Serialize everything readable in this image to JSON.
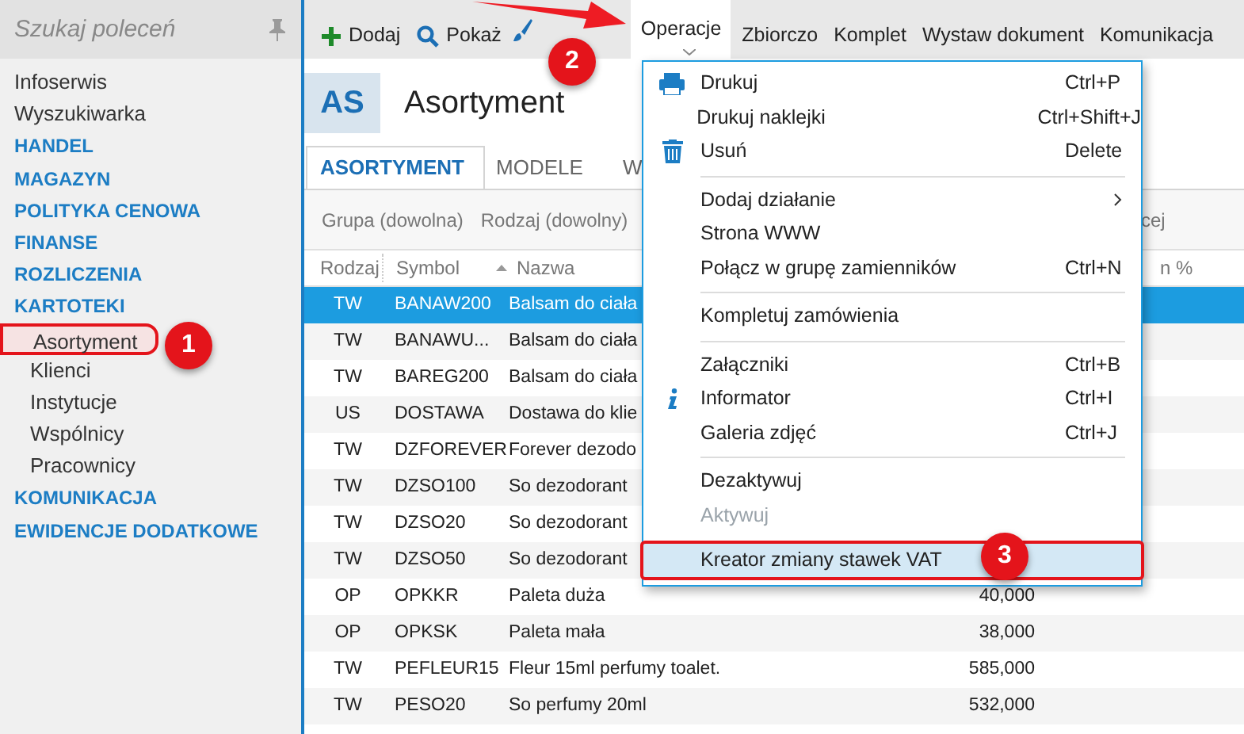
{
  "sidebar": {
    "search": {
      "placeholder": "Szukaj poleceń"
    },
    "items": [
      {
        "label": "Infoserwis",
        "kind": "link"
      },
      {
        "label": "Wyszukiwarka",
        "kind": "link"
      },
      {
        "label": "HANDEL",
        "kind": "section"
      },
      {
        "label": "MAGAZYN",
        "kind": "section"
      },
      {
        "label": "POLITYKA CENOWA",
        "kind": "section"
      },
      {
        "label": "FINANSE",
        "kind": "section"
      },
      {
        "label": "ROZLICZENIA",
        "kind": "section"
      },
      {
        "label": "KARTOTEKI",
        "kind": "section",
        "children": [
          {
            "label": "Asortyment",
            "selected": true
          },
          {
            "label": "Klienci",
            "selected": false
          },
          {
            "label": "Instytucje",
            "selected": false
          },
          {
            "label": "Wspólnicy",
            "selected": false
          },
          {
            "label": "Pracownicy",
            "selected": false
          }
        ]
      },
      {
        "label": "KOMUNIKACJA",
        "kind": "section"
      },
      {
        "label": "EWIDENCJE DODATKOWE",
        "kind": "section"
      }
    ]
  },
  "toolbar": [
    {
      "label": "Dodaj",
      "selected": false
    },
    {
      "label": "Pokaż",
      "selected": false
    },
    {
      "selected": false
    },
    {
      "label": "Operacje",
      "selected": true
    },
    {
      "label": "Zbiorczo",
      "selected": false
    },
    {
      "label": "Komplet",
      "selected": false
    },
    {
      "label": "Wystaw dokument",
      "selected": false
    },
    {
      "label": "Komunikacja",
      "selected": false
    }
  ],
  "header": {
    "badge": "AS",
    "title": "Asortyment"
  },
  "tabs": [
    {
      "label": "ASORTYMENT",
      "selected": true
    },
    {
      "label": "MODELE",
      "selected": false
    },
    {
      "label": "W",
      "selected": false
    }
  ],
  "filters": [
    "Grupa (dowolna)",
    "Rodzaj (dowolny)"
  ],
  "filter_right": "cej",
  "table": {
    "columns": [
      "Rodzaj",
      "Symbol",
      "Nazwa"
    ],
    "column_right": "n %",
    "rows": [
      {
        "rodzaj": "TW",
        "symbol": "BANAW200",
        "nazwa": "Balsam do ciała",
        "selected": true
      },
      {
        "rodzaj": "TW",
        "symbol": "BANAWU...",
        "nazwa": "Balsam do ciała",
        "selected": false
      },
      {
        "rodzaj": "TW",
        "symbol": "BAREG200",
        "nazwa": "Balsam do ciała",
        "selected": false
      },
      {
        "rodzaj": "US",
        "symbol": "DOSTAWA",
        "nazwa": "Dostawa do klie",
        "selected": false
      },
      {
        "rodzaj": "TW",
        "symbol": "DZFOREVER",
        "nazwa": "Forever dezodo",
        "selected": false
      },
      {
        "rodzaj": "TW",
        "symbol": "DZSO100",
        "nazwa": "So dezodorant",
        "selected": false
      },
      {
        "rodzaj": "TW",
        "symbol": "DZSO20",
        "nazwa": "So dezodorant",
        "selected": false
      },
      {
        "rodzaj": "TW",
        "symbol": "DZSO50",
        "nazwa": "So dezodorant",
        "selected": false
      },
      {
        "rodzaj": "OP",
        "symbol": "OPKKR",
        "nazwa": "Paleta duża",
        "column_4": "40,000",
        "selected": false
      },
      {
        "rodzaj": "OP",
        "symbol": "OPKSK",
        "nazwa": "Paleta mała",
        "column_4": "38,000",
        "selected": false
      },
      {
        "rodzaj": "TW",
        "symbol": "PEFLEUR15",
        "nazwa": "Fleur 15ml perfumy toalet.",
        "column_4": "585,000",
        "selected": false
      },
      {
        "rodzaj": "TW",
        "symbol": "PESO20",
        "nazwa": "So perfumy 20ml",
        "column_4": "532,000",
        "selected": false
      }
    ]
  },
  "menu": [
    {
      "kind": "item",
      "label": "Drukuj",
      "shortcut": "Ctrl+P",
      "disabled": false,
      "selected": false
    },
    {
      "kind": "item",
      "label": "Drukuj naklejki",
      "shortcut": "Ctrl+Shift+J",
      "disabled": false,
      "selected": false
    },
    {
      "kind": "item",
      "label": "Usuń",
      "shortcut": "Delete",
      "disabled": false,
      "selected": false
    },
    {
      "kind": "separator"
    },
    {
      "kind": "submenu",
      "label": "Dodaj działanie",
      "disabled": false,
      "selected": false
    },
    {
      "kind": "item",
      "label": "Strona WWW",
      "disabled": false,
      "selected": false
    },
    {
      "kind": "item",
      "label": "Połącz w grupę zamienników",
      "shortcut": "Ctrl+N",
      "disabled": false,
      "selected": false
    },
    {
      "kind": "separator"
    },
    {
      "kind": "item",
      "label": "Kompletuj zamówienia",
      "disabled": false,
      "selected": false
    },
    {
      "kind": "separator"
    },
    {
      "kind": "item",
      "label": "Załączniki",
      "shortcut": "Ctrl+B",
      "disabled": false,
      "selected": false
    },
    {
      "kind": "item",
      "label": "Informator",
      "shortcut": "Ctrl+I",
      "disabled": false,
      "selected": false
    },
    {
      "kind": "item",
      "label": "Galeria zdjęć",
      "shortcut": "Ctrl+J",
      "disabled": false,
      "selected": false
    },
    {
      "kind": "separator"
    },
    {
      "kind": "item",
      "label": "Dezaktywuj",
      "disabled": false,
      "selected": false
    },
    {
      "kind": "item",
      "label": "Aktywuj",
      "disabled": true,
      "selected": false
    },
    {
      "kind": "item",
      "label": "Kreator zmiany stawek VAT",
      "disabled": false,
      "selected": true
    }
  ],
  "callouts": [
    "1",
    "2",
    "3"
  ]
}
